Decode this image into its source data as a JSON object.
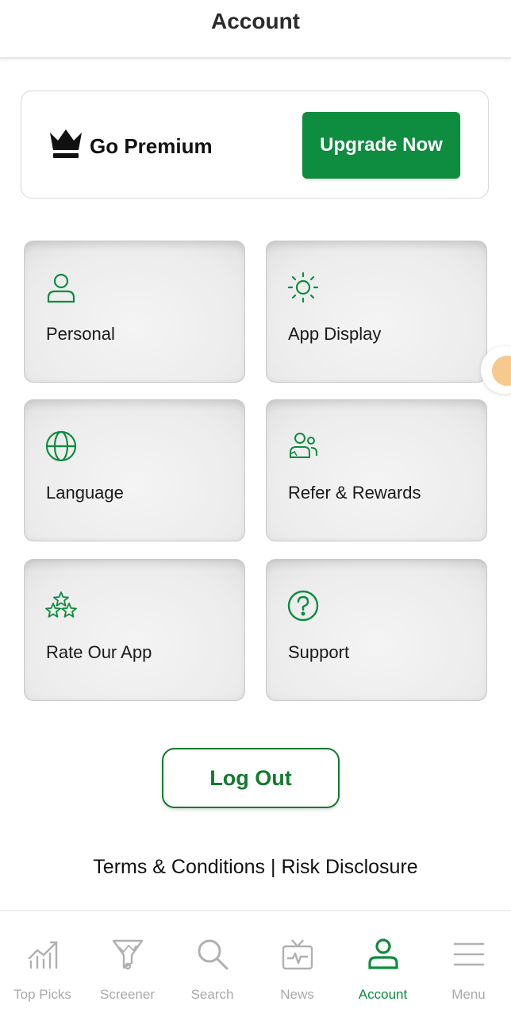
{
  "header": {
    "title": "Account"
  },
  "premium": {
    "label": "Go Premium",
    "button_label": "Upgrade Now",
    "accent": "#0e8c3f"
  },
  "tiles": [
    {
      "label": "Personal",
      "icon": "person-icon"
    },
    {
      "label": "App Display",
      "icon": "sun-icon"
    },
    {
      "label": "Language",
      "icon": "globe-icon"
    },
    {
      "label": "Refer & Rewards",
      "icon": "refer-people-icon"
    },
    {
      "label": "Rate Our App",
      "icon": "stars-icon"
    },
    {
      "label": "Support",
      "icon": "help-icon"
    }
  ],
  "logout_label": "Log Out",
  "footer_links": {
    "terms": "Terms & Conditions",
    "separator": " | ",
    "risk": "Risk Disclosure"
  },
  "bottom_nav": [
    {
      "label": "Top Picks",
      "icon": "chart-bars-icon",
      "active": false
    },
    {
      "label": "Screener",
      "icon": "screener-funnel-icon",
      "active": false
    },
    {
      "label": "Search",
      "icon": "search-icon",
      "active": false
    },
    {
      "label": "News",
      "icon": "tv-icon",
      "active": false
    },
    {
      "label": "Account",
      "icon": "account-icon",
      "active": true
    },
    {
      "label": "Menu",
      "icon": "hamburger-menu-icon",
      "active": false
    }
  ],
  "colors": {
    "brand_green": "#0e8c3f",
    "inactive_gray": "#a9a9a9"
  }
}
